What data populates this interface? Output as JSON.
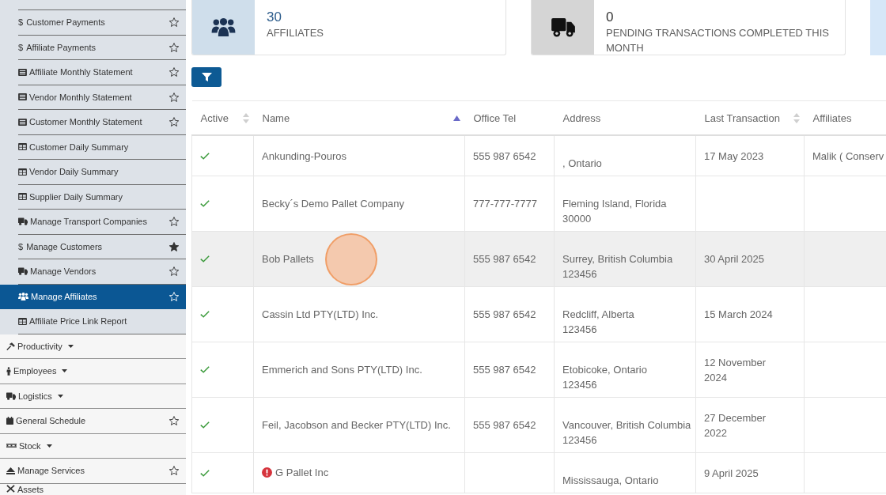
{
  "sidebar": {
    "submenu": [
      {
        "label": "Customer Payments",
        "kind": "glyph",
        "glyph": "$",
        "starred": false,
        "selected": false
      },
      {
        "label": "Affiliate Payments",
        "kind": "glyph",
        "glyph": "$",
        "starred": false,
        "selected": false
      },
      {
        "label": "Affiliate Monthly Statement",
        "kind": "statement",
        "starred": false,
        "selected": false
      },
      {
        "label": "Vendor Monthly Statement",
        "kind": "statement",
        "starred": false,
        "selected": false
      },
      {
        "label": "Customer Monthly Statement",
        "kind": "statement",
        "starred": false,
        "selected": false
      },
      {
        "label": "Customer Daily Summary",
        "kind": "summary",
        "selected": false
      },
      {
        "label": "Vendor Daily Summary",
        "kind": "summary",
        "selected": false
      },
      {
        "label": "Supplier Daily Summary",
        "kind": "summary",
        "selected": false
      },
      {
        "label": "Manage Transport Companies",
        "kind": "truck",
        "starred": false,
        "selected": false
      },
      {
        "label": "Manage Customers",
        "kind": "glyph",
        "glyph": "$",
        "starred": true,
        "selected": false
      },
      {
        "label": "Manage Vendors",
        "kind": "truck",
        "starred": false,
        "selected": false
      },
      {
        "label": "Manage Affiliates",
        "kind": "users",
        "starred": false,
        "selected": true
      },
      {
        "label": "Affiliate Price Link Report",
        "kind": "summary",
        "selected": false
      }
    ],
    "items": [
      {
        "label": "Productivity",
        "kind": "hammer",
        "expanded": false,
        "selected": false
      },
      {
        "label": "Employees",
        "kind": "person",
        "expanded": false,
        "selected": false
      },
      {
        "label": "Logistics",
        "kind": "truck",
        "expanded": false,
        "selected": false
      },
      {
        "label": "General Schedule",
        "kind": "calendar",
        "starred": false,
        "selected": false
      },
      {
        "label": "Stock",
        "kind": "pallet",
        "expanded": false,
        "selected": false
      },
      {
        "label": "Manage Services",
        "kind": "eject",
        "starred": false,
        "selected": false
      },
      {
        "label": "Assets",
        "kind": "tools",
        "selected": false
      }
    ]
  },
  "stats": [
    {
      "kind": "affiliates",
      "value": "30",
      "label": "AFFILIATES"
    },
    {
      "kind": "transactions",
      "value": "0",
      "label": "PENDING TRANSACTIONS COMPLETED THIS MONTH"
    },
    {
      "kind": "info"
    }
  ],
  "toolbar": [
    {
      "kind": "filter"
    }
  ],
  "table": {
    "columns": [
      {
        "label": "Active",
        "kind": "sortable"
      },
      {
        "label": "Name",
        "kind": "ascending"
      },
      {
        "label": "Office Tel",
        "kind": "plain"
      },
      {
        "label": "Address",
        "kind": "plain"
      },
      {
        "label": "Last Transaction",
        "kind": "sortable"
      },
      {
        "label": "Affiliates",
        "kind": "plain"
      }
    ],
    "rows": [
      {
        "active": true,
        "alert": false,
        "hovered": false,
        "name": "Ankunding-Pouros",
        "office_tel": "555 987 6542",
        "address": ", Ontario",
        "last_transaction": "17 May 2023",
        "affiliates": "Malik ( Conserv"
      },
      {
        "active": true,
        "alert": false,
        "hovered": false,
        "name": "Becky´s Demo Pallet Company",
        "office_tel": "777-777-7777",
        "address": "Fleming Island, Florida\n30000"
      },
      {
        "active": true,
        "alert": false,
        "hovered": true,
        "name": "Bob Pallets",
        "office_tel": "555 987 6542",
        "address": "Surrey, British Columbia\n123456",
        "last_transaction": "30 April 2025"
      },
      {
        "active": true,
        "alert": false,
        "hovered": false,
        "name": "Cassin Ltd PTY(LTD) Inc.",
        "office_tel": "555 987 6542",
        "address": "Redcliff, Alberta\n123456",
        "last_transaction": "15 March 2024"
      },
      {
        "active": true,
        "alert": false,
        "hovered": false,
        "name": "Emmerich and Sons PTY(LTD) Inc.",
        "office_tel": "555 987 6542",
        "address": "Etobicoke, Ontario\n123456",
        "last_transaction": "12 November 2024"
      },
      {
        "active": true,
        "alert": false,
        "hovered": false,
        "name": "Feil, Jacobson and Becker PTY(LTD) Inc.",
        "office_tel": "555 987 6542",
        "address": "Vancouver, British Columbia\n123456",
        "last_transaction": "27 December 2022"
      },
      {
        "active": true,
        "alert": true,
        "hovered": false,
        "name": "G Pallet Inc",
        "address": "Mississauga, Ontario",
        "last_transaction": "9 April 2025"
      }
    ]
  }
}
